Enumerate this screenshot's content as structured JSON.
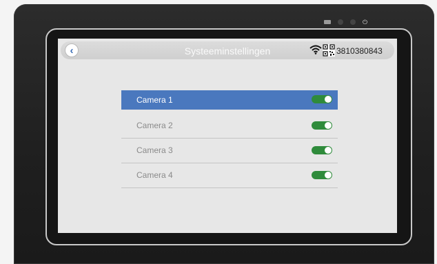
{
  "header": {
    "title": "Systeeminstellingen",
    "device_id": "3810380843",
    "icons": {
      "back": "chevron-left-icon",
      "wifi": "wifi-icon",
      "qr": "qr-code-icon"
    }
  },
  "cameras": [
    {
      "label": "Camera 1",
      "enabled": true,
      "selected": true
    },
    {
      "label": "Camera 2",
      "enabled": true,
      "selected": false
    },
    {
      "label": "Camera 3",
      "enabled": true,
      "selected": false
    },
    {
      "label": "Camera 4",
      "enabled": true,
      "selected": false
    }
  ],
  "colors": {
    "accent": "#4a78be",
    "toggle_on": "#2f8b3b"
  }
}
